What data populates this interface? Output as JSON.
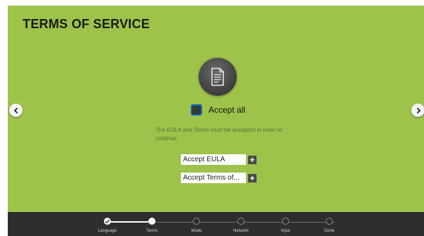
{
  "page": {
    "title": "TERMS OF SERVICE",
    "accept_all_label": "Accept all",
    "notice": "The EULA and Terms must be accepted in order to continue.",
    "buttons": {
      "eula": "Accept EULA",
      "terms": "Accept Terms of..."
    }
  },
  "icons": {
    "document": "document-icon",
    "prev": "chevron-left-icon",
    "next": "chevron-right-icon",
    "plus": "plus-icon",
    "check": "checkmark-icon"
  },
  "colors": {
    "background": "#9dc34b",
    "footer": "#2e2e2e",
    "checkbox_border": "#1565c0"
  },
  "steps": {
    "items": [
      {
        "label": "Language",
        "state": "completed"
      },
      {
        "label": "Terms",
        "state": "current"
      },
      {
        "label": "Mode",
        "state": "pending"
      },
      {
        "label": "Network",
        "state": "pending"
      },
      {
        "label": "Input",
        "state": "pending"
      },
      {
        "label": "Done",
        "state": "pending"
      }
    ]
  }
}
